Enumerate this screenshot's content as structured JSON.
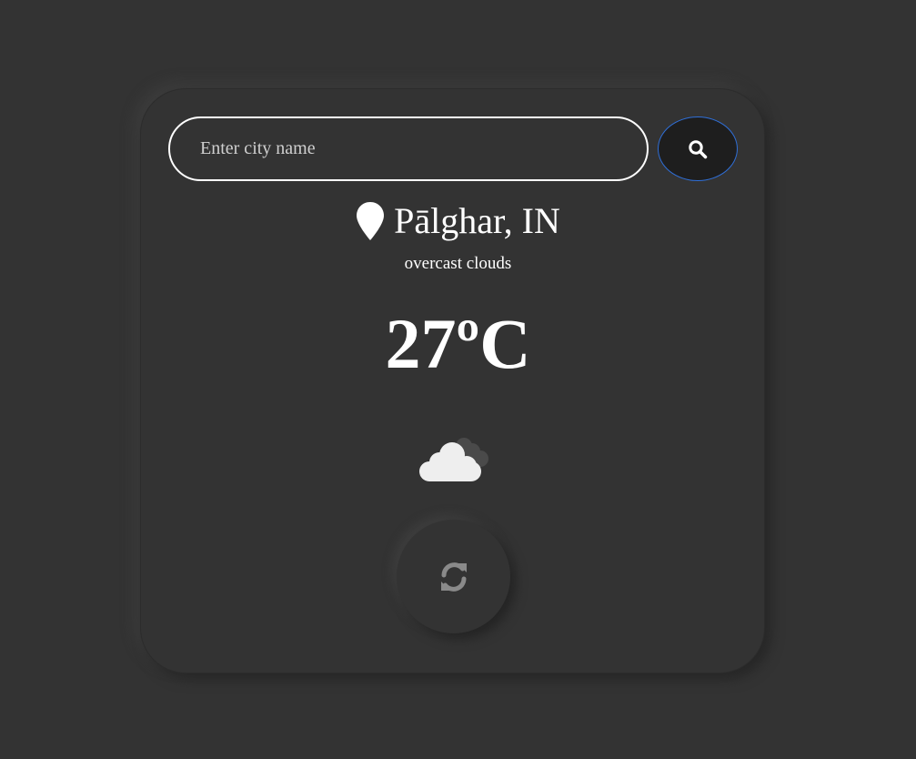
{
  "search": {
    "placeholder": "Enter city name",
    "value": ""
  },
  "location": {
    "city": "Pālghar, IN"
  },
  "weather": {
    "description": "overcast clouds",
    "temperature": "27ºC",
    "icon": "overcast-clouds-icon"
  },
  "icons": {
    "search": "search-icon",
    "pin": "map-pin-icon",
    "refresh": "refresh-icon"
  },
  "colors": {
    "background": "#333333",
    "search_border": "#ffffff",
    "search_button_bg": "#1e1e1e",
    "search_button_border": "#2f6fd8",
    "refresh_icon": "#8a8a8a"
  }
}
